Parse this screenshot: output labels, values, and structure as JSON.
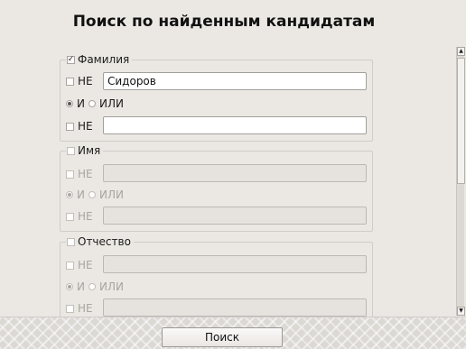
{
  "title": "Поиск по найденным кандидатам",
  "groups": [
    {
      "label": "Фамилия",
      "checked": true,
      "enabled": true,
      "not_label": "НЕ",
      "and_label": "И",
      "or_label": "ИЛИ",
      "first_value": "Сидоров",
      "second_value": ""
    },
    {
      "label": "Имя",
      "checked": false,
      "enabled": false,
      "not_label": "НЕ",
      "and_label": "И",
      "or_label": "ИЛИ",
      "first_value": "",
      "second_value": ""
    },
    {
      "label": "Отчество",
      "checked": false,
      "enabled": false,
      "not_label": "НЕ",
      "and_label": "И",
      "or_label": "ИЛИ",
      "first_value": "",
      "second_value": ""
    }
  ],
  "search_button": "Поиск",
  "colors": {
    "background": "#ebe8e4",
    "disabled_text": "#a8a5a0"
  },
  "icons": {
    "scroll_up": "arrow-up-icon",
    "scroll_down": "arrow-down-icon"
  }
}
